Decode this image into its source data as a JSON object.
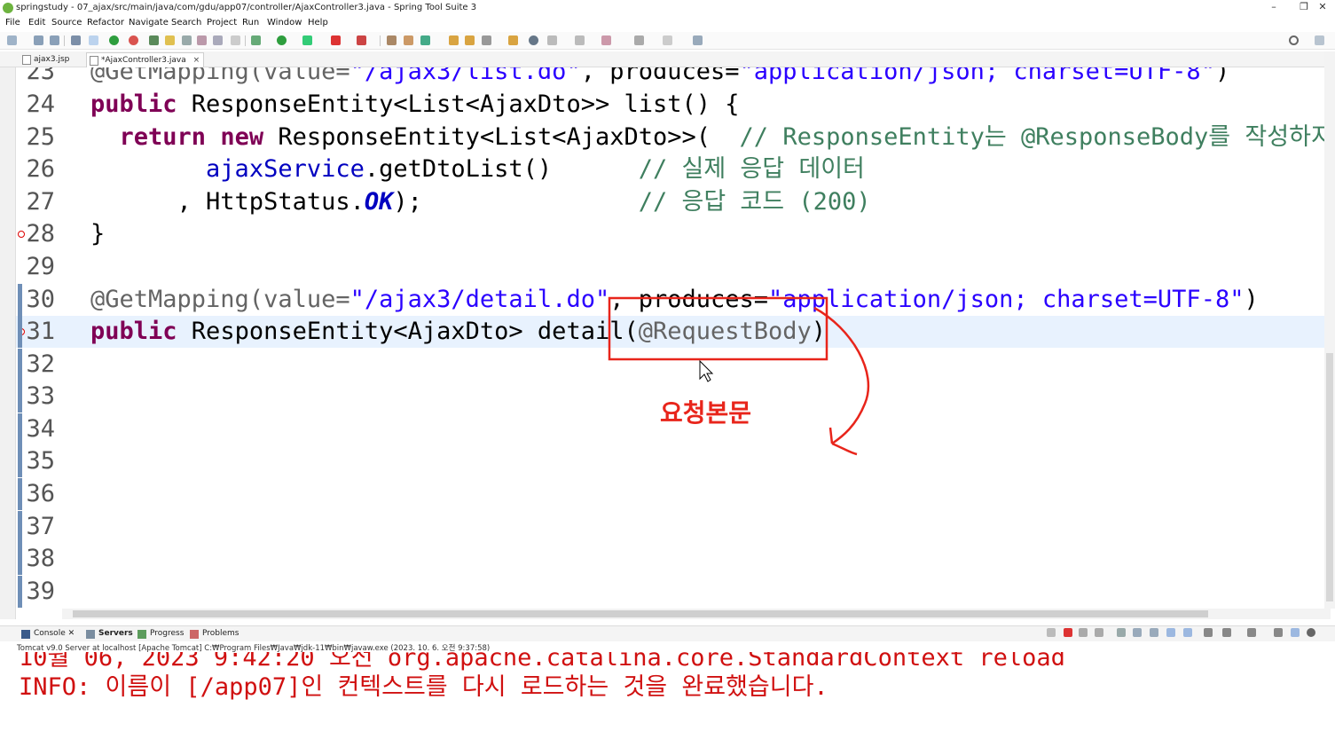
{
  "window": {
    "title": "springstudy - 07_ajax/src/main/java/com/gdu/app07/controller/AjaxController3.java - Spring Tool Suite 3",
    "minimize": "–",
    "restore": "❐",
    "close": "✕"
  },
  "menu": [
    "File",
    "Edit",
    "Source",
    "Refactor",
    "Navigate",
    "Search",
    "Project",
    "Run",
    "Window",
    "Help"
  ],
  "tabs": [
    {
      "label": "ajax3.jsp",
      "active": false
    },
    {
      "label": "*AjaxController3.java",
      "active": true,
      "close": "×"
    }
  ],
  "editor": {
    "lines": [
      {
        "num": "23",
        "text": "@GetMapping(value=\"/ajax3/list.do\", produces=\"application/json; charset=UTF-8\")"
      },
      {
        "num": "24",
        "text": "public ResponseEntity<List<AjaxDto>> list() {"
      },
      {
        "num": "25",
        "text": "  return new ResponseEntity<List<AjaxDto>>(  // ResponseEntity는 @ResponseBody를 작성하지"
      },
      {
        "num": "26",
        "text": "        ajaxService.getDtoList()      // 실제 응답 데이터"
      },
      {
        "num": "27",
        "text": "      , HttpStatus.OK);               // 응답 코드 (200)"
      },
      {
        "num": "28",
        "text": "}"
      },
      {
        "num": "29",
        "text": ""
      },
      {
        "num": "30",
        "text": "@GetMapping(value=\"/ajax3/detail.do\", produces=\"application/json; charset=UTF-8\")"
      },
      {
        "num": "31",
        "text": "public ResponseEntity<AjaxDto> detail(@RequestBody)"
      },
      {
        "num": "32",
        "text": ""
      },
      {
        "num": "33",
        "text": ""
      },
      {
        "num": "34",
        "text": ""
      },
      {
        "num": "35",
        "text": ""
      },
      {
        "num": "36",
        "text": ""
      },
      {
        "num": "37",
        "text": ""
      },
      {
        "num": "38",
        "text": ""
      },
      {
        "num": "39",
        "text": ""
      }
    ]
  },
  "annotation_note": "요청본문",
  "bottom_panel": {
    "tabs": [
      "Console",
      "Servers",
      "Progress",
      "Problems"
    ],
    "console_header": "Tomcat v9.0 Server at localhost [Apache Tomcat] C:₩Program Files₩Java₩jdk-11₩bin₩javaw.exe  (2023. 10. 6. 오전 9:37:58)",
    "output": [
      "10월 06, 2023 9:42:20 오전 org.apache.catalina.core.StandardContext reload",
      "INFO: 이름이 [/app07]인 컨텍스트를 다시 로드하는 것을 완료했습니다."
    ]
  },
  "colors": {
    "keyword": "#7f0055",
    "string": "#2a00ff",
    "comment": "#3f7f5f",
    "field": "#0000c0",
    "console_error": "#d01010",
    "annotation_red": "#e8251b",
    "current_line": "#e8f2fe"
  }
}
